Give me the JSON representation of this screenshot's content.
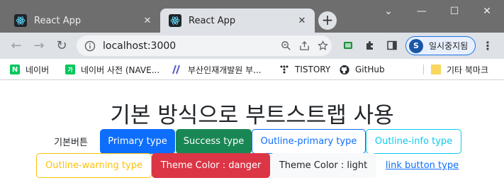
{
  "browser": {
    "tabs": [
      {
        "title": "React App",
        "active": false
      },
      {
        "title": "React App",
        "active": true
      }
    ],
    "new_tab_symbol": "+",
    "window_controls": {
      "chevron": "⌄",
      "minimize": "—",
      "maximize": "☐",
      "close": "✕"
    },
    "url": "localhost:3000",
    "profile": {
      "initial": "S",
      "label": "일시중지됨"
    }
  },
  "bookmarks": [
    {
      "label": "네이버",
      "icon": "naver-icon"
    },
    {
      "label": "네이버 사전 (NAVE...",
      "icon": "naver-dict-icon"
    },
    {
      "label": "부산인재개발원 부...",
      "icon": "slash-logo-icon"
    },
    {
      "label": "TISTORY",
      "icon": "tistory-icon"
    },
    {
      "label": "GitHub",
      "icon": "github-icon"
    },
    {
      "label": "기타 북마크",
      "icon": "folder-icon"
    }
  ],
  "page": {
    "heading": "기본 방식으로 부트스트랩 사용",
    "buttons": [
      {
        "label": "기본버튼",
        "variant": "plain"
      },
      {
        "label": "Primary type",
        "variant": "primary"
      },
      {
        "label": "Success type",
        "variant": "success"
      },
      {
        "label": "Outline-primary type",
        "variant": "outline-primary"
      },
      {
        "label": "Outline-info type",
        "variant": "outline-info"
      },
      {
        "label": "Outline-warning type",
        "variant": "outline-warning"
      },
      {
        "label": "Theme Color : danger",
        "variant": "danger"
      },
      {
        "label": "Theme Color : light",
        "variant": "light"
      },
      {
        "label": "link button type",
        "variant": "link"
      }
    ]
  },
  "colors": {
    "primary": "#0d6efd",
    "success": "#198754",
    "info": "#0dcaf0",
    "warning": "#ffc107",
    "danger": "#dc3545",
    "light": "#f8f9fa"
  }
}
